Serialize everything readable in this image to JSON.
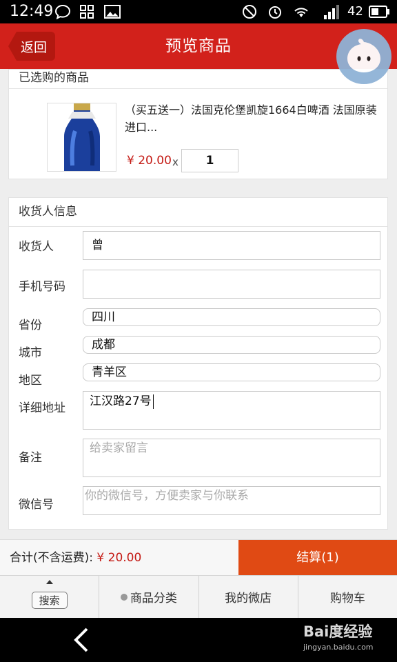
{
  "status_bar": {
    "time": "12:49",
    "battery_level": "42",
    "network": "3G"
  },
  "header": {
    "back_label": "返回",
    "title": "预览商品"
  },
  "selected_goods": {
    "section_title": "已选购的商品",
    "product_name": "（买五送一）法国克伦堡凯旋1664白啤酒 法国原装进口...",
    "price": "¥ 20.00",
    "times_sign": "x",
    "quantity": "1"
  },
  "receiver": {
    "section_title": "收货人信息",
    "fields": {
      "name": {
        "label": "收货人",
        "value": "曾"
      },
      "phone": {
        "label": "手机号码",
        "value": ""
      },
      "province": {
        "label": "省份",
        "value": "四川"
      },
      "city": {
        "label": "城市",
        "value": "成都"
      },
      "district": {
        "label": "地区",
        "value": "青羊区"
      },
      "address": {
        "label": "详细地址",
        "value": "江汉路27号"
      },
      "note": {
        "label": "备注",
        "placeholder": "给卖家留言"
      },
      "wechat": {
        "label": "微信号",
        "placeholder": "你的微信号，方便卖家与你联系"
      }
    }
  },
  "total": {
    "label": "合计(不含运费): ",
    "amount": "¥ 20.00",
    "checkout_label": "结算(1)"
  },
  "bottom_nav": {
    "search": "搜索",
    "categories": "商品分类",
    "my_shop": "我的微店",
    "cart": "购物车"
  },
  "watermark": {
    "logo": "Bai度经验",
    "url": "jingyan.baidu.com"
  },
  "colors": {
    "header_red": "#d2211b",
    "price_red": "#c41a14",
    "checkout_orange": "#e04a14"
  }
}
